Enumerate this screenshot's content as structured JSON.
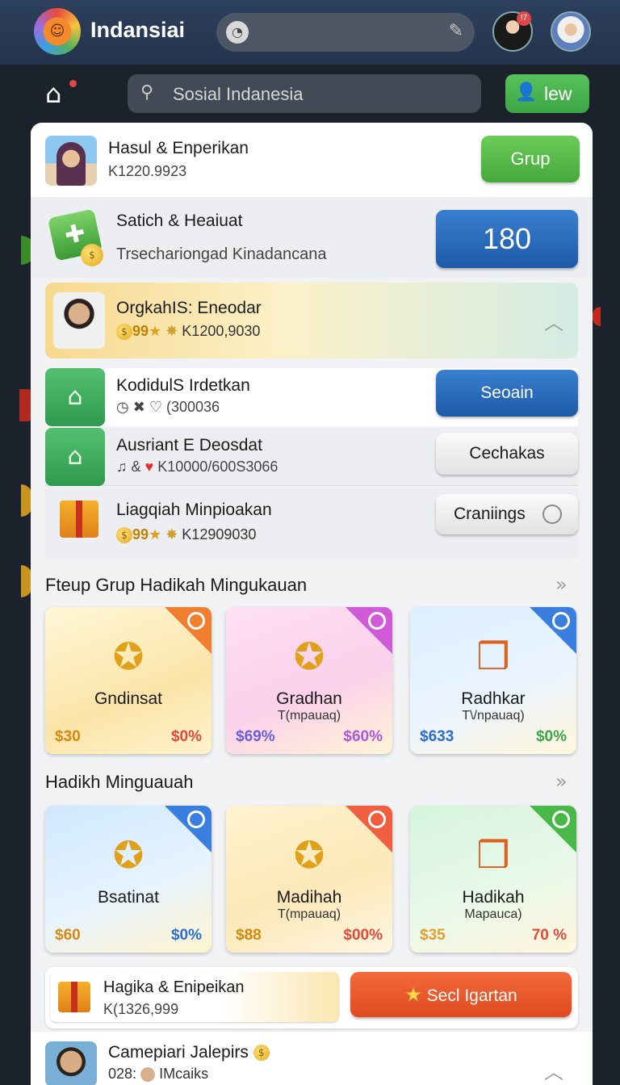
{
  "topbar": {
    "brand": "Indansiai",
    "notif_count": "!7"
  },
  "subbar": {
    "search_placeholder": "Sosial Indanesia",
    "new_label": "lew"
  },
  "profile": {
    "name": "Hasul & Enperikan",
    "id": "K1220.9923",
    "button": "Grup"
  },
  "stats": {
    "title": "Satich & Heaiuat",
    "subtitle": "Trsechariongad Kinadancana",
    "value": "180"
  },
  "highlight": {
    "title": "OrgkahIS: Eneodar",
    "coins": "99",
    "code": "K1200,9030"
  },
  "list": [
    {
      "title": "KodidulS Irdetkan",
      "meta": "(300036",
      "button": "Seoain"
    },
    {
      "title": "Ausriant E Deosdat",
      "meta": "K10000/600S3066",
      "button": "Cechakas"
    },
    {
      "title": "Liagqiah Minpioakan",
      "coins": "99",
      "meta": "K12909030",
      "button": "Craniings"
    }
  ],
  "section1": {
    "title": "Fteup Grup Hadikah Mingukauan",
    "cards": [
      {
        "name": "Gndinsat",
        "sub": "",
        "left": "$30",
        "right": "$0%",
        "color_left": "#d28a10",
        "color_right": "#e24a3a"
      },
      {
        "name": "Gradhan",
        "sub": "T(mpauaq)",
        "left": "$69%",
        "right": "$60%",
        "color_left": "#6b5fd8",
        "color_right": "#b058d8"
      },
      {
        "name": "Radhkar",
        "sub": "T\\/npauaq)",
        "left": "$633",
        "right": "$0%",
        "color_left": "#2a6fd0",
        "color_right": "#3aa648"
      }
    ]
  },
  "section2": {
    "title": "Hadikh Minguauah",
    "cards": [
      {
        "name": "Bsatinat",
        "sub": "",
        "left": "$60",
        "right": "$0%",
        "color_left": "#d28a10",
        "color_right": "#2a6fd0"
      },
      {
        "name": "Madihah",
        "sub": "T(mpauaq)",
        "left": "$88",
        "right": "$00%",
        "color_left": "#d28a10",
        "color_right": "#e24a3a"
      },
      {
        "name": "Hadikah",
        "sub": "Mapauca)",
        "left": "$35",
        "right": "70 %",
        "color_left": "#e0a030",
        "color_right": "#e24a3a"
      }
    ]
  },
  "promo": {
    "title": "Hagika & Enipeikan",
    "code": "K(1326,999",
    "button": "Secl Igartan"
  },
  "bottom_user": {
    "name": "Camepiari Jalepirs",
    "meta_prefix": "028:",
    "meta": "IMcaiks"
  }
}
